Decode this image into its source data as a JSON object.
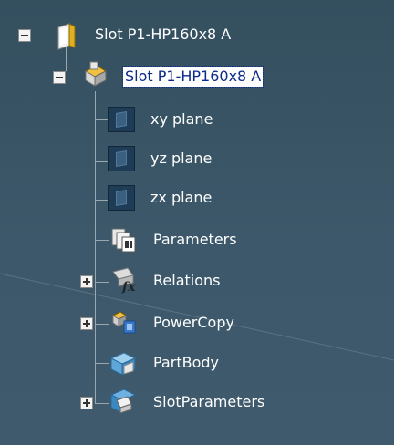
{
  "tree": {
    "root": {
      "label": "Slot P1-HP160x8 A",
      "icon": "part-document-icon"
    },
    "part": {
      "label": "Slot P1-HP160x8 A",
      "icon": "part-icon",
      "selected": true
    },
    "children": [
      {
        "label": "xy plane",
        "icon": "plane-icon",
        "expandable": false
      },
      {
        "label": "yz plane",
        "icon": "plane-icon",
        "expandable": false
      },
      {
        "label": "zx plane",
        "icon": "plane-icon",
        "expandable": false
      },
      {
        "label": "Parameters",
        "icon": "parameters-icon",
        "expandable": false
      },
      {
        "label": "Relations",
        "icon": "relations-icon",
        "expandable": true
      },
      {
        "label": "PowerCopy",
        "icon": "powercopy-icon",
        "expandable": true
      },
      {
        "label": "PartBody",
        "icon": "partbody-icon",
        "expandable": false
      },
      {
        "label": "SlotParameters",
        "icon": "slot-parameters-icon",
        "expandable": true
      }
    ]
  },
  "colors": {
    "background": "#3a5567",
    "selection_text": "#0b2a8a",
    "tree_line": "#9aa7af"
  }
}
